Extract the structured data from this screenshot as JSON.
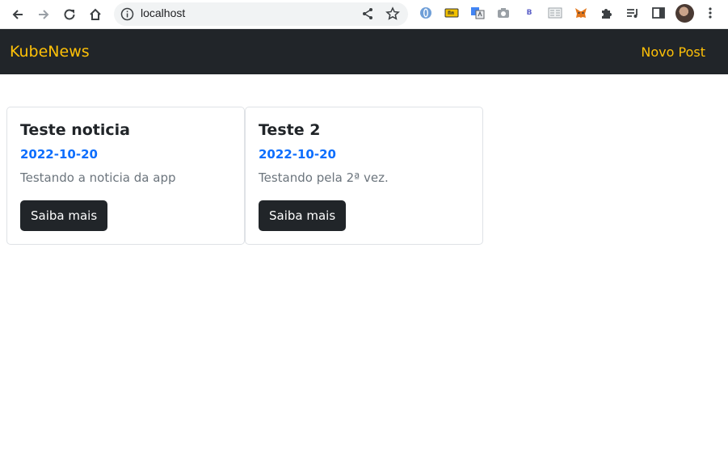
{
  "browser": {
    "url": "localhost",
    "extensions": [
      "opera-icon",
      "notes-icon",
      "translate-icon",
      "camera-icon",
      "b-icon",
      "reader-icon",
      "metamask-icon",
      "puzzle-icon",
      "media-icon",
      "sidepanel-icon"
    ],
    "b_extension_text": "B"
  },
  "navbar": {
    "brand": "KubeNews",
    "new_post": "Novo Post",
    "accent": "#ffc107",
    "background": "#212529"
  },
  "posts": [
    {
      "title": "Teste noticia",
      "date": "2022-10-20",
      "summary": "Testando a noticia da app",
      "button": "Saiba mais"
    },
    {
      "title": "Teste 2",
      "date": "2022-10-20",
      "summary": "Testando pela 2ª vez.",
      "button": "Saiba mais"
    }
  ]
}
